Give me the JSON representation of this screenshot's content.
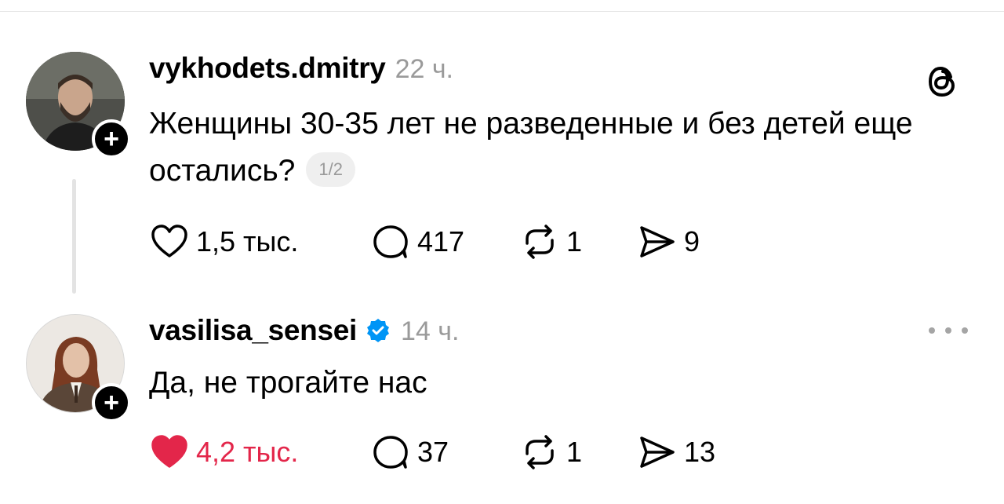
{
  "posts": [
    {
      "username": "vykhodets.dmitry",
      "timestamp": "22 ч.",
      "text": "Женщины 30-35 лет не разведенные и без детей еще остались?",
      "pager": "1/2",
      "verified": false,
      "liked": false,
      "likes": "1,5 тыс.",
      "replies": "417",
      "reposts": "1",
      "shares": "9",
      "icon": "threads-logo-icon"
    },
    {
      "username": "vasilisa_sensei",
      "timestamp": "14 ч.",
      "text": "Да, не трогайте нас",
      "verified": true,
      "liked": true,
      "likes": "4,2 тыс.",
      "replies": "37",
      "reposts": "1",
      "shares": "13",
      "icon": "more-options-icon"
    }
  ],
  "colors": {
    "like_active": "#e3264a",
    "verified": "#0095f6",
    "muted": "#9a9a9a"
  }
}
